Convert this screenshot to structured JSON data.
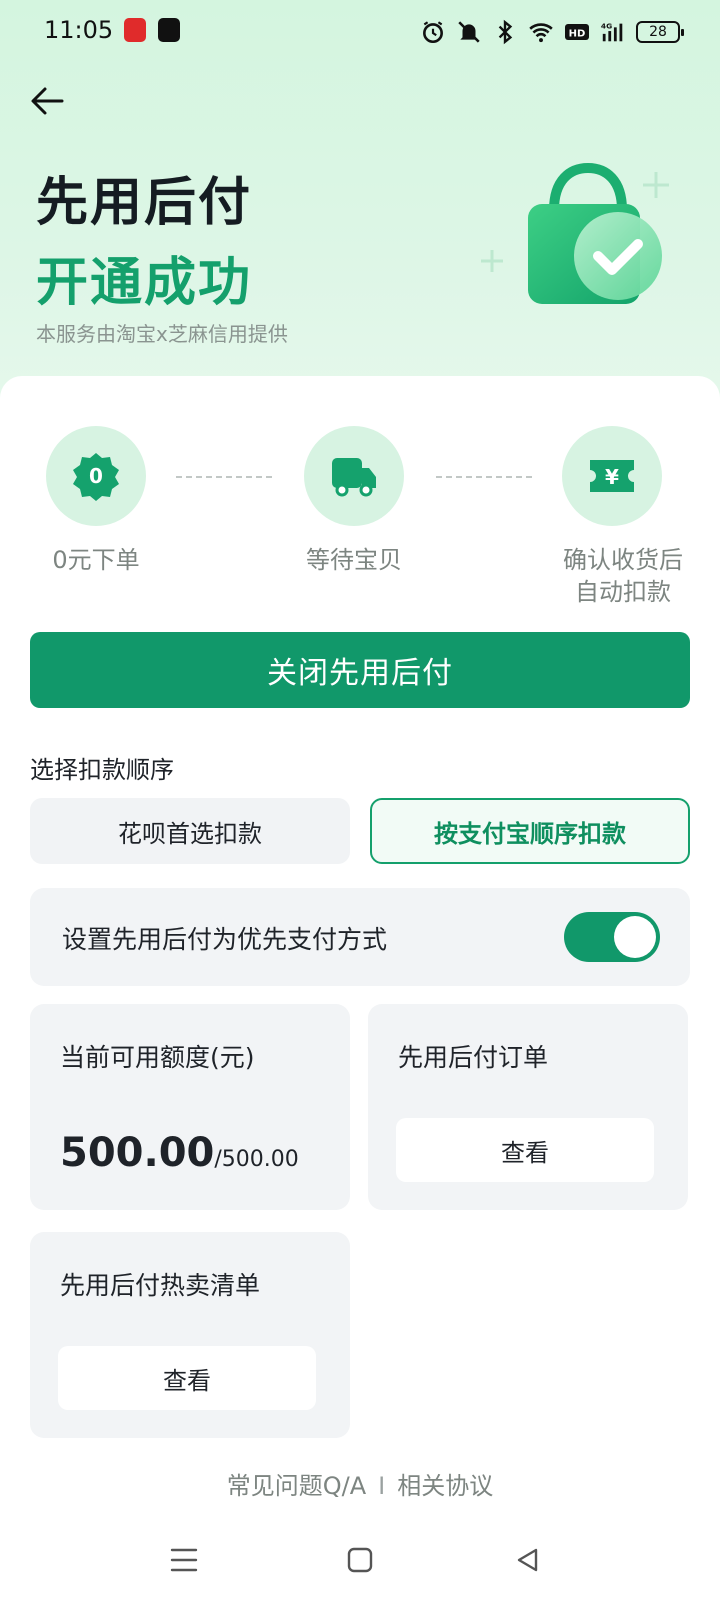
{
  "status_bar": {
    "time": "11:05",
    "battery": "28",
    "network": "4G",
    "hd": "HD",
    "icons": [
      "alarm-icon",
      "mute-icon",
      "bluetooth-icon",
      "wifi-icon",
      "hd-icon",
      "signal-icon",
      "battery-icon"
    ]
  },
  "header": {
    "title_line1": "先用后付",
    "title_line2": "开通成功",
    "subtitle": "本服务由淘宝x芝麻信用提供"
  },
  "steps": [
    {
      "icon": "zero-badge-icon",
      "badge": "0",
      "label": "0元下单"
    },
    {
      "icon": "delivery-truck-icon",
      "label": "等待宝贝"
    },
    {
      "icon": "ticket-yen-icon",
      "badge": "¥",
      "label_line1": "确认收货后",
      "label_line2": "自动扣款"
    }
  ],
  "actions": {
    "close_label": "关闭先用后付"
  },
  "payment_order": {
    "label": "选择扣款顺序",
    "options": [
      "花呗首选扣款",
      "按支付宝顺序扣款"
    ],
    "selected": "按支付宝顺序扣款"
  },
  "preference": {
    "label": "设置先用后付为优先支付方式",
    "enabled": true
  },
  "quota": {
    "title": "当前可用额度(元)",
    "available": "500.00",
    "total": "/500.00"
  },
  "orders": {
    "title": "先用后付订单",
    "view_label": "查看"
  },
  "hot_list": {
    "title": "先用后付热卖清单",
    "view_label": "查看"
  },
  "footer": {
    "faq": "常见问题Q/A",
    "separator": "I",
    "agreement": "相关协议"
  },
  "colors": {
    "accent": "#11986a",
    "accent_text": "#14a06c",
    "hero_bg": "#d4f5df"
  }
}
